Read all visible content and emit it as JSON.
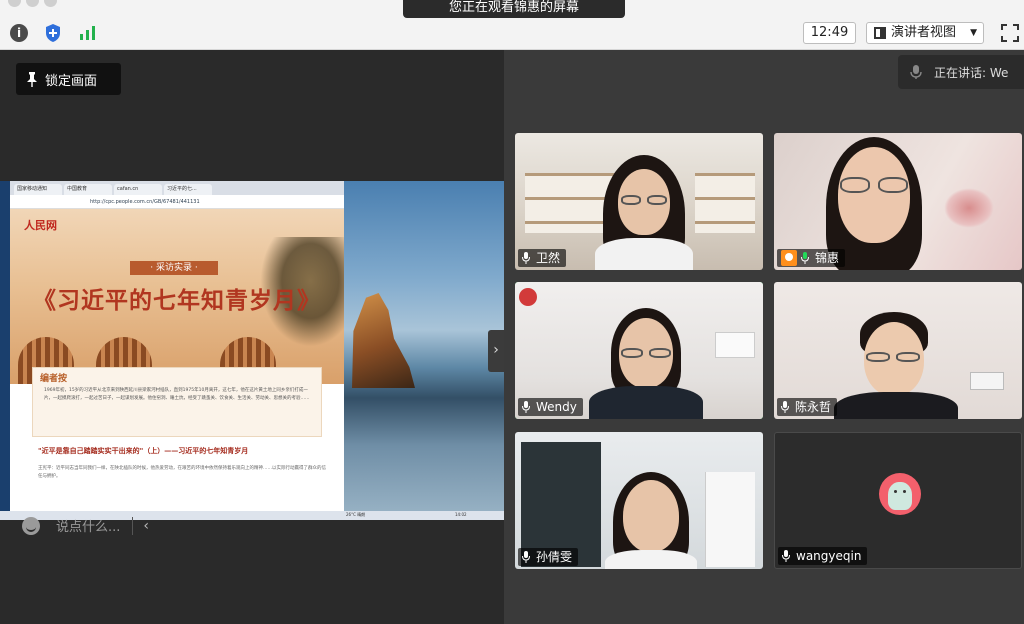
{
  "topbar": {
    "share_banner": "您正在观看锦惠的屏幕",
    "time": "12:49",
    "view_button": "演讲者视图"
  },
  "share": {
    "lock_button": "锁定画面",
    "browser_tabs": [
      "国家移动通知",
      "中国教育",
      "cafan.cn",
      "习近平的七..."
    ],
    "browser_url": "http://cpc.people.com.cn/GB/67481/441131",
    "poster_logo": "人民网",
    "poster_subtitle": "· 采访实录 ·",
    "poster_title": "《习近平的七年知青岁月》",
    "editor_tag": "编者按",
    "editor_text": "1969年初，15岁的习近平从北京来到陕西延川县梁家河村插队，直到1975年10月离开，这七年，他在这片黄土地上同乡亲们打成一片，一起摸爬滚打，一起过苦日子，一起谋划发展。他住窑洞、睡土炕，经受了跳蚤关、饮食关、生活关、劳动关、思想关的考验……",
    "article_heading": "\"近平是靠自己踏踏实实干出来的\"（上）——习近平的七年知青岁月",
    "article_text": "王宪平：近平同志当年同我们一样，在陕北插队的时候，他热爱劳动，在艰苦的环境中依然保持着乐观向上的精神……以实际行动赢得了群众的信任与拥护。",
    "taskbar_weather": "26°C 晴朗",
    "taskbar_time": "14:02",
    "chat_placeholder": "说点什么..."
  },
  "gallery": {
    "speaking_label": "正在讲话: We",
    "participants": [
      {
        "name": "卫然",
        "host": false,
        "active": false
      },
      {
        "name": "锦惠",
        "host": true,
        "active": false
      },
      {
        "name": "Wendy",
        "host": false,
        "active": true
      },
      {
        "name": "陈永哲",
        "host": false,
        "active": false
      },
      {
        "name": "孙倩雯",
        "host": false,
        "active": false
      },
      {
        "name": "wangyeqin",
        "host": false,
        "active": false
      }
    ]
  },
  "colors": {
    "active_border": "#23d959",
    "host_badge": "#ff8f1c"
  }
}
